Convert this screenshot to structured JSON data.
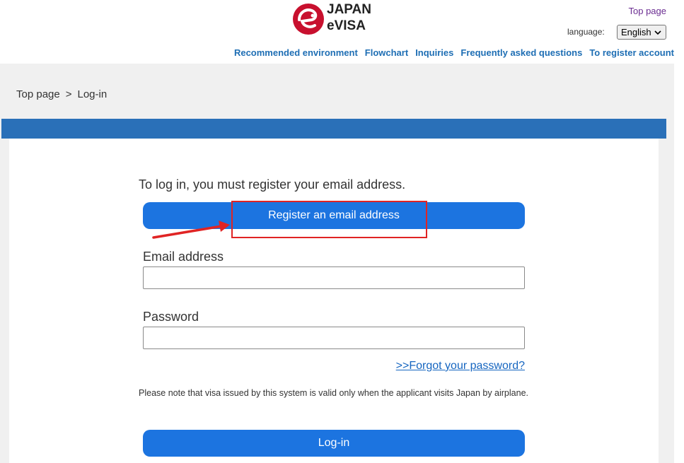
{
  "header": {
    "logo": {
      "line1": "JAPAN",
      "line2": "eVISA",
      "mark_color": "#c8102e"
    },
    "top_page_link": "Top page",
    "language_label": "language:",
    "language_value": "English",
    "nav": [
      "Recommended environment",
      "Flowchart",
      "Inquiries",
      "Frequently asked questions",
      "To register account"
    ]
  },
  "breadcrumb": {
    "home": "Top page",
    "separator": ">",
    "current": "Log-in"
  },
  "login": {
    "intro": "To log in, you must register your email address.",
    "register_button": "Register an email address",
    "email_label": "Email address",
    "email_value": "",
    "password_label": "Password",
    "password_value": "",
    "forgot_link": ">>Forgot your password?",
    "notice": "Please note that visa issued by this system is valid only when the applicant visits Japan by airplane.",
    "login_button": "Log-in"
  },
  "colors": {
    "accent_blue": "#1c74e0",
    "bar_blue": "#2a70b8",
    "nav_link": "#1e6eb4",
    "annotation_red": "#e02424"
  }
}
